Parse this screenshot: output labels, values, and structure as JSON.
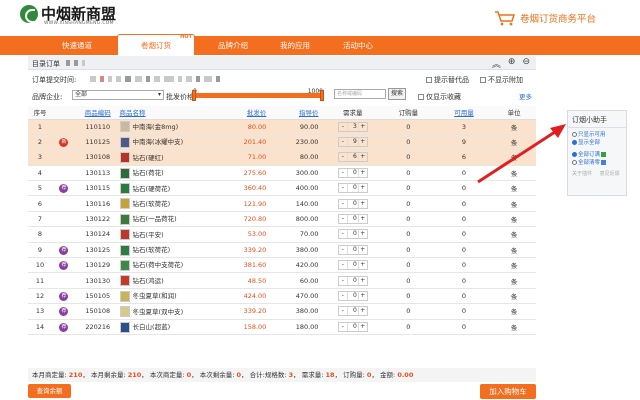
{
  "header": {
    "logo_text": "中烟新商盟",
    "logo_sub": "WWW.XINSHANGMENG.COM",
    "platform_title": "卷烟订货商务平台"
  },
  "nav": {
    "items": [
      {
        "label": "快速通道"
      },
      {
        "label": "卷烟订货",
        "badge": "HOT",
        "active": true
      },
      {
        "label": "品牌介绍"
      },
      {
        "label": "我的应用"
      },
      {
        "label": "活动中心"
      }
    ]
  },
  "order": {
    "title": "目录订单",
    "deadline_label": "订单提交时间:",
    "show_alt_label": "提示替代品",
    "hide_zero_label": "不显示附加",
    "brand_label": "品牌企业:",
    "brand_value": "全部",
    "price_label": "批发价格:",
    "price_min": "0",
    "price_max": "1000",
    "search_placeholder": "名称或编码",
    "search_button": "搜索",
    "favorites_only": "仅显示收藏",
    "more": "更多"
  },
  "table": {
    "headers": [
      "序号",
      "商品编码",
      "商品名称",
      "批发价",
      "指导价",
      "需求量",
      "订购量",
      "可用量",
      "单位"
    ],
    "rows": [
      {
        "idx": "1",
        "badge": "",
        "code": "110110",
        "name": "中南海(金8mg)",
        "price": "80.00",
        "guide": "90.00",
        "qty": "3",
        "order": "0",
        "avail": "3",
        "unit": "条",
        "selected": true,
        "img": "#c9b9a0"
      },
      {
        "idx": "2",
        "badge": "新",
        "badge_color": "red",
        "code": "110125",
        "name": "中南海(冰耀中支)",
        "price": "201.40",
        "guide": "230.00",
        "qty": "9",
        "order": "0",
        "avail": "9",
        "unit": "条",
        "selected": true,
        "img": "#4a5a8a"
      },
      {
        "idx": "3",
        "badge": "",
        "code": "130108",
        "name": "钻石(硬红)",
        "price": "71.00",
        "guide": "80.00",
        "qty": "6",
        "order": "0",
        "avail": "6",
        "unit": "条",
        "selected": true,
        "img": "#b8332a"
      },
      {
        "idx": "4",
        "badge": "",
        "code": "130113",
        "name": "钻石(荷花)",
        "price": "275.60",
        "guide": "300.00",
        "qty": "0",
        "order": "0",
        "avail": "0",
        "unit": "条",
        "selected": false,
        "img": "#2e6a3a"
      },
      {
        "idx": "5",
        "badge": "荐",
        "badge_color": "purple",
        "code": "130115",
        "name": "钻石(硬荷花)",
        "price": "360.40",
        "guide": "400.00",
        "qty": "0",
        "order": "0",
        "avail": "0",
        "unit": "条",
        "selected": false,
        "img": "#2a7a44"
      },
      {
        "idx": "6",
        "badge": "",
        "code": "130116",
        "name": "钻石(软荷花)",
        "price": "121.90",
        "guide": "140.00",
        "qty": "0",
        "order": "0",
        "avail": "0",
        "unit": "条",
        "selected": false,
        "img": "#c4a23a"
      },
      {
        "idx": "7",
        "badge": "",
        "code": "130122",
        "name": "钻石(一品荷花)",
        "price": "720.80",
        "guide": "800.00",
        "qty": "0",
        "order": "0",
        "avail": "0",
        "unit": "条",
        "selected": false,
        "img": "#3d7a3a"
      },
      {
        "idx": "8",
        "badge": "",
        "code": "130124",
        "name": "钻石(平安)",
        "price": "53.00",
        "guide": "70.00",
        "qty": "0",
        "order": "0",
        "avail": "0",
        "unit": "条",
        "selected": false,
        "img": "#b93a2c"
      },
      {
        "idx": "9",
        "badge": "荐",
        "badge_color": "purple",
        "code": "130125",
        "name": "钻石(软荷花)",
        "price": "339.20",
        "guide": "380.00",
        "qty": "0",
        "order": "0",
        "avail": "0",
        "unit": "条",
        "selected": false,
        "img": "#2f7b40"
      },
      {
        "idx": "10",
        "badge": "荐",
        "badge_color": "purple",
        "code": "130129",
        "name": "钻石(荷中支荷花)",
        "price": "381.60",
        "guide": "420.00",
        "qty": "0",
        "order": "0",
        "avail": "0",
        "unit": "条",
        "selected": false,
        "img": "#3b8a4a"
      },
      {
        "idx": "11",
        "badge": "",
        "code": "130130",
        "name": "钻石(鸿运)",
        "price": "48.50",
        "guide": "60.00",
        "qty": "0",
        "order": "0",
        "avail": "0",
        "unit": "条",
        "selected": false,
        "img": "#c23a2a"
      },
      {
        "idx": "12",
        "badge": "荐",
        "badge_color": "purple",
        "code": "150105",
        "name": "冬虫夏草(和润)",
        "price": "424.00",
        "guide": "470.00",
        "qty": "0",
        "order": "0",
        "avail": "0",
        "unit": "条",
        "selected": false,
        "img": "#c9b35a"
      },
      {
        "idx": "13",
        "badge": "荐",
        "badge_color": "purple",
        "code": "150108",
        "name": "冬虫夏草(双中支)",
        "price": "339.20",
        "guide": "380.00",
        "qty": "0",
        "order": "0",
        "avail": "0",
        "unit": "条",
        "selected": false,
        "img": "#d8c88a"
      },
      {
        "idx": "14",
        "badge": "荐",
        "badge_color": "purple",
        "code": "220216",
        "name": "长白山(超蓝)",
        "price": "158.00",
        "guide": "180.00",
        "qty": "0",
        "order": "0",
        "avail": "0",
        "unit": "条",
        "selected": false,
        "img": "#2c4e8a"
      }
    ]
  },
  "footer": {
    "month_quota_label": "本月商定量:",
    "month_quota": "210",
    "month_remain_label": "本月剩余量:",
    "month_remain": "210",
    "this_quota_label": "本次商定量:",
    "this_quota": "0",
    "this_remain_label": "本次剩余量:",
    "this_remain": "0",
    "total_label": "合计:规格数:",
    "spec_count": "3",
    "demand_label": "需求量:",
    "demand": "18",
    "order_label": "订购量:",
    "order_qty": "0",
    "amount_label": "金额:",
    "amount": "0.00",
    "query_balance": "查询余额",
    "add_to_cart": "加入购物车"
  },
  "helper": {
    "title": "订烟小助手",
    "opt_available": "只显示可用",
    "opt_all": "显示全部",
    "opt_order_all": "全部订满",
    "opt_clear_all": "全部清零",
    "foot_close": "关于插件",
    "foot_feedback": "意见反馈"
  },
  "colors": {
    "brand_orange": "#f36e1f",
    "selected_row": "#fbe2cc",
    "price_red": "#e0501c",
    "logo_green": "#2e8b3a"
  }
}
